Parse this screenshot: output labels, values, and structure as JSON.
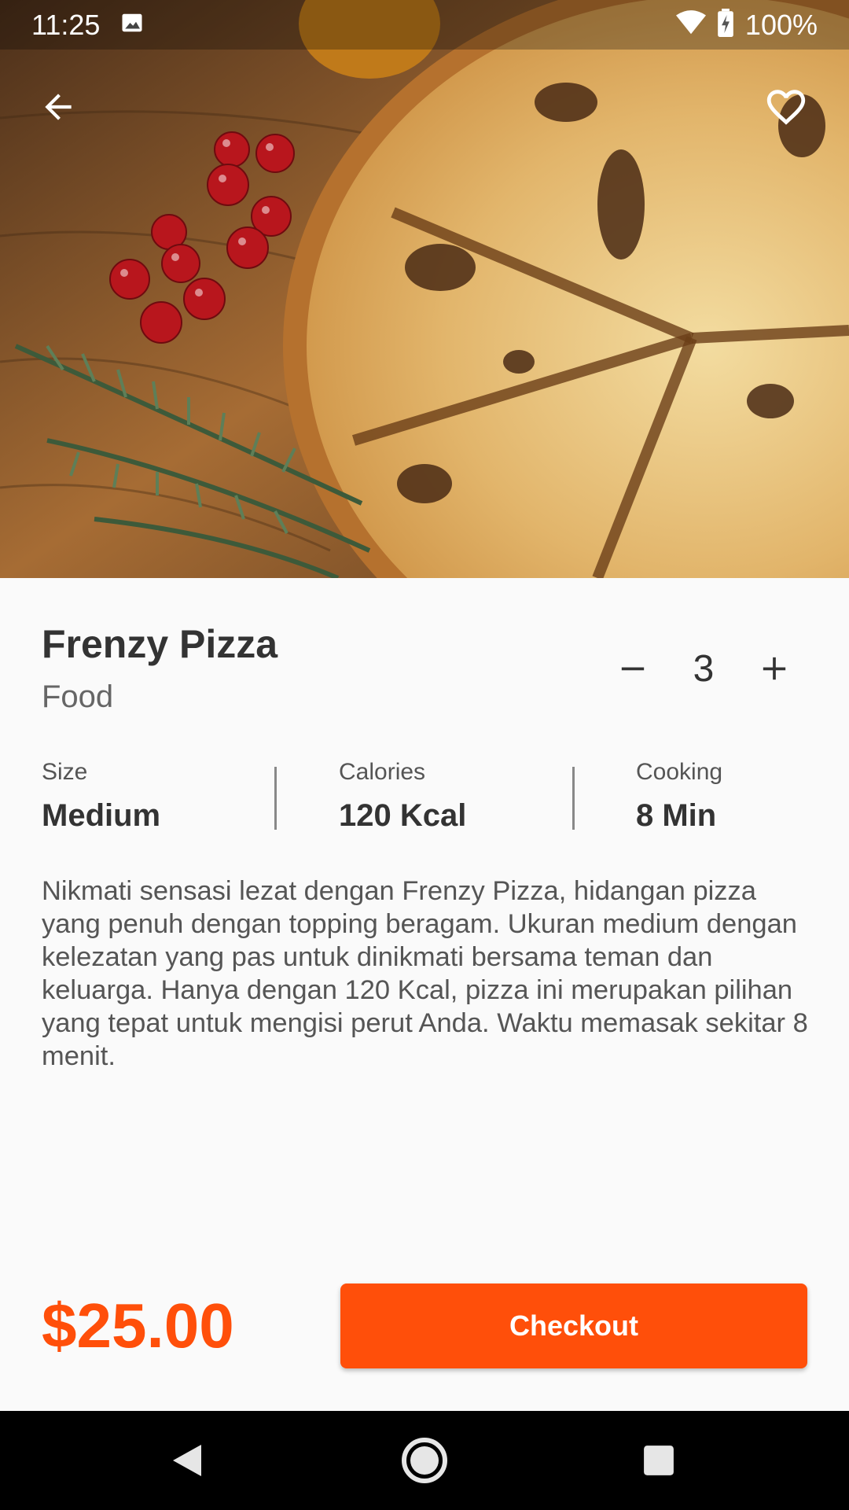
{
  "status_bar": {
    "time": "11:25",
    "battery": "100%",
    "icons": [
      "image-icon",
      "wifi-icon",
      "battery-charging-icon"
    ]
  },
  "hero": {
    "image_alt": "pizza with cherry tomatoes and rosemary",
    "back_icon": "arrow-left-icon",
    "favorite_icon": "heart-outline-icon"
  },
  "product": {
    "name": "Frenzy Pizza",
    "category": "Food",
    "quantity": "3",
    "decrease_symbol": "−",
    "increase_symbol": "+"
  },
  "details": [
    {
      "label": "Size",
      "value": "Medium"
    },
    {
      "label": "Calories",
      "value": "120 Kcal"
    },
    {
      "label": "Cooking",
      "value": "8 Min"
    }
  ],
  "description": "Nikmati sensasi lezat dengan Frenzy Pizza, hidangan pizza yang penuh dengan topping beragam. Ukuran medium dengan kelezatan yang pas untuk dinikmati bersama teman dan keluarga. Hanya dengan 120 Kcal, pizza ini merupakan pilihan yang tepat untuk mengisi perut Anda. Waktu memasak sekitar 8 menit.",
  "footer": {
    "price": "$25.00",
    "checkout_label": "Checkout"
  },
  "colors": {
    "accent": "#ff4f0a",
    "background": "#fafafa",
    "text_primary": "#333333",
    "text_secondary": "#555555"
  },
  "nav_bar": {
    "icons": [
      "nav-back-icon",
      "nav-home-icon",
      "nav-recents-icon"
    ]
  }
}
